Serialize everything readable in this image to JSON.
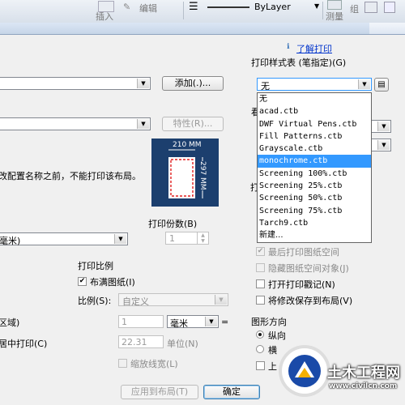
{
  "toolbar": {
    "insert_label": "插入",
    "edit_label": "编辑",
    "linetype_label": "ByLayer",
    "measure_label": "测量",
    "right_label": "组"
  },
  "plot_style": {
    "help_link": "了解打印",
    "title": "打印样式表 (笔指定)(G)",
    "selected": "无",
    "options": [
      "无",
      "acad.ctb",
      "DWF Virtual Pens.ctb",
      "Fill Patterns.ctb",
      "Grayscale.ctb",
      "monochrome.ctb",
      "Screening 100%.ctb",
      "Screening 25%.ctb",
      "Screening 50%.ctb",
      "Screening 75%.ctb",
      "Tarch9.ctb",
      "新建..."
    ],
    "highlighted_index": 5
  },
  "page_setup": {
    "add_button": "添加(.)..."
  },
  "printer": {
    "properties_button": "特性(R)...",
    "note_text": "改配置名称之前，不能打印该布局。",
    "partial_right_label": "看"
  },
  "preview": {
    "width_label": "210 MM",
    "height_label": "297 MM"
  },
  "paper_size": {
    "value": "毫米)"
  },
  "copies": {
    "label": "打印份数(B)",
    "value": "1"
  },
  "plot_scale": {
    "group_title": "打印比例",
    "fit_paper_label": "布满图纸(I)",
    "fit_paper_checked": true,
    "scale_label": "比例(S):",
    "scale_value": "自定义",
    "value1": "1",
    "unit_value": "毫米",
    "value2": "22.31",
    "unit_label": "单位(N)",
    "lineweight_label": "缩放线宽(L)"
  },
  "plot_area": {
    "partial_label": "区域)",
    "center_label": "居中打印(C)"
  },
  "options": {
    "items": [
      {
        "label": "最后打印图纸空间",
        "checked": true,
        "enabled": false
      },
      {
        "label": "隐藏图纸空间对象(J)",
        "checked": false,
        "enabled": false
      },
      {
        "label": "打开打印戳记(N)",
        "checked": false,
        "enabled": true
      },
      {
        "label": "将修改保存到布局(V)",
        "checked": false,
        "enabled": true
      }
    ]
  },
  "orientation": {
    "title": "图形方向",
    "portrait": "纵向",
    "landscape": "横",
    "upside": "上"
  },
  "footer": {
    "apply_button": "应用到布局(T)",
    "ok_button": "确定"
  },
  "watermark": {
    "title": "土木工程网",
    "url": "www.civilcn.com"
  },
  "colors": {
    "accent": "#3399ff",
    "preview_bg": "#1c3f6e",
    "link": "#0033cc"
  }
}
